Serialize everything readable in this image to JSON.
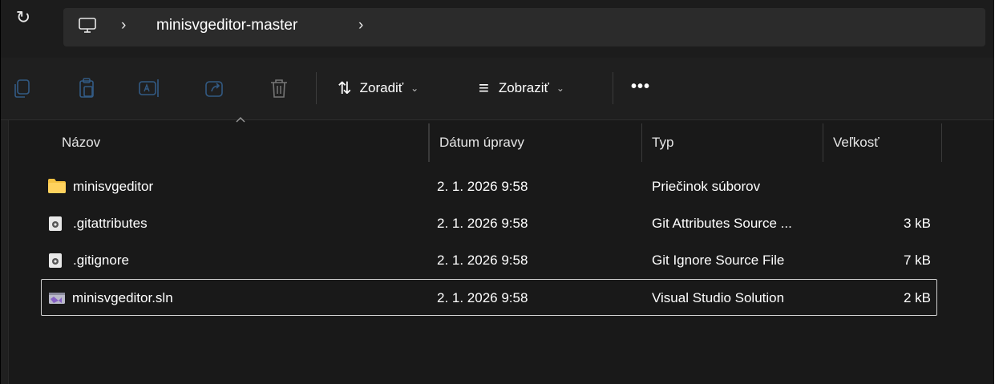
{
  "address": {
    "folder": "minisvgeditor-master",
    "separator": "›",
    "refresh_glyph": "↻"
  },
  "toolbar": {
    "sort_label": "Zoradiť",
    "view_label": "Zobraziť",
    "chevron": "⌄",
    "more": "•••",
    "sort_glyph": "⇅",
    "view_glyph": "≡"
  },
  "columns": {
    "name": "Názov",
    "date": "Dátum úpravy",
    "type": "Typ",
    "size": "Veľkosť"
  },
  "files": [
    {
      "name": "minisvgeditor",
      "date": "2. 1. 2026 9:58",
      "type": "Priečinok súborov",
      "size": "",
      "icon": "folder-icon"
    },
    {
      "name": ".gitattributes",
      "date": "2. 1. 2026 9:58",
      "type": "Git Attributes Source ...",
      "size": "3 kB",
      "icon": "settings-file-icon"
    },
    {
      "name": ".gitignore",
      "date": "2. 1. 2026 9:58",
      "type": "Git Ignore Source File",
      "size": "7 kB",
      "icon": "settings-file-icon"
    },
    {
      "name": "minisvgeditor.sln",
      "date": "2. 1. 2026 9:58",
      "type": "Visual Studio Solution",
      "size": "2 kB",
      "icon": "visual-studio-solution-icon"
    }
  ],
  "colors": {
    "folder": "#f5c242",
    "vs_purple": "#8661c5",
    "background": "#191919"
  }
}
